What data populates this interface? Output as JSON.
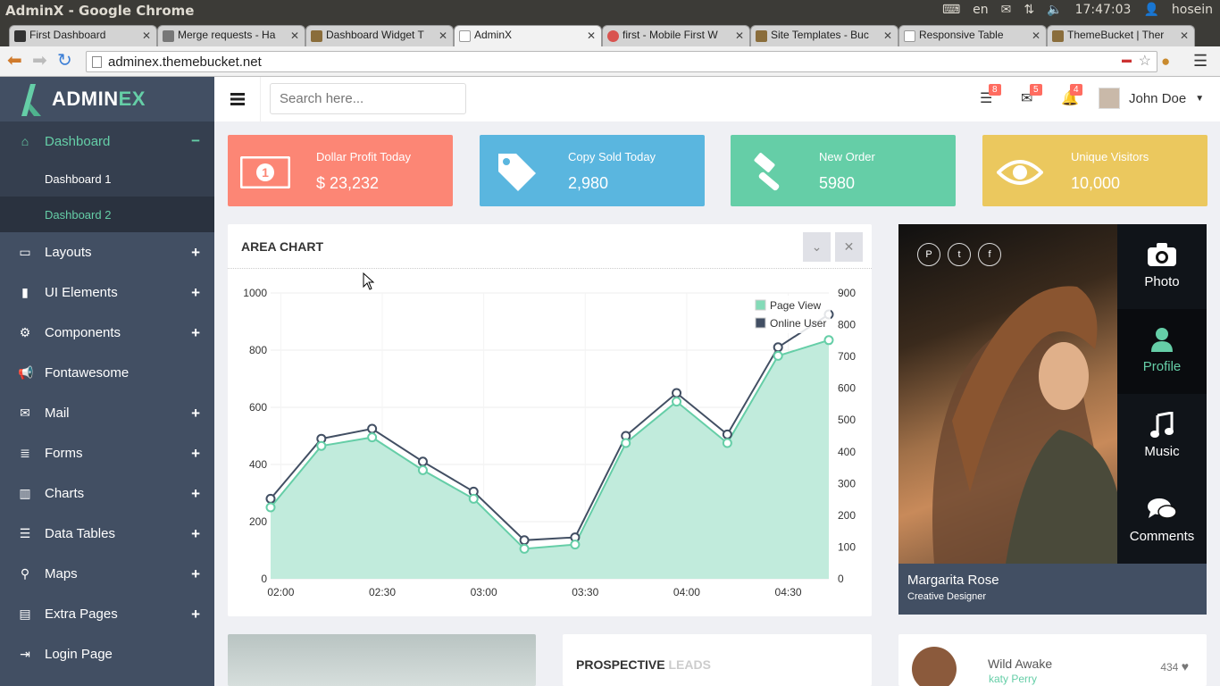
{
  "os": {
    "window_title": "AdminX - Google Chrome",
    "keyboard_lang": "en",
    "clock": "17:47:03",
    "user": "hosein"
  },
  "browser": {
    "tabs": [
      {
        "label": "First Dashboard",
        "active": false
      },
      {
        "label": "Merge requests - Ha",
        "active": false
      },
      {
        "label": "Dashboard Widget T",
        "active": false
      },
      {
        "label": "AdminX",
        "active": true
      },
      {
        "label": "first - Mobile First W",
        "active": false
      },
      {
        "label": "Site Templates - Buc",
        "active": false
      },
      {
        "label": "Responsive Table",
        "active": false
      },
      {
        "label": "ThemeBucket | Ther",
        "active": false
      }
    ],
    "url": "adminex.themebucket.net"
  },
  "brand": {
    "name_a": "ADMIN",
    "name_b": "EX"
  },
  "sidebar": {
    "items": [
      {
        "label": "Dashboard",
        "toggle": "−",
        "active": true
      },
      {
        "label": "Layouts",
        "toggle": "+"
      },
      {
        "label": "UI Elements",
        "toggle": "+"
      },
      {
        "label": "Components",
        "toggle": "+"
      },
      {
        "label": "Fontawesome",
        "toggle": ""
      },
      {
        "label": "Mail",
        "toggle": "+"
      },
      {
        "label": "Forms",
        "toggle": "+"
      },
      {
        "label": "Charts",
        "toggle": "+"
      },
      {
        "label": "Data Tables",
        "toggle": "+"
      },
      {
        "label": "Maps",
        "toggle": "+"
      },
      {
        "label": "Extra Pages",
        "toggle": "+"
      },
      {
        "label": "Login Page",
        "toggle": ""
      }
    ],
    "submenu": [
      "Dashboard 1",
      "Dashboard 2"
    ]
  },
  "header": {
    "search_placeholder": "Search here...",
    "badges": {
      "tasks": "8",
      "messages": "5",
      "notifications": "4"
    },
    "user_name": "John Doe"
  },
  "stats": [
    {
      "title": "Dollar Profit Today",
      "value": "$ 23,232",
      "color": "#fc8675"
    },
    {
      "title": "Copy Sold Today",
      "value": "2,980",
      "color": "#5ab6df"
    },
    {
      "title": "New Order",
      "value": "5980",
      "color": "#65cea7"
    },
    {
      "title": "Unique Visitors",
      "value": "10,000",
      "color": "#ebc85e"
    }
  ],
  "chart_panel": {
    "title": "AREA CHART"
  },
  "chart_data": {
    "type": "area",
    "x_ticks": [
      "02:00",
      "02:30",
      "03:00",
      "03:30",
      "04:00",
      "04:30"
    ],
    "y_left_ticks": [
      "1000",
      "800",
      "600",
      "400",
      "200",
      "0"
    ],
    "y_right_ticks": [
      "900",
      "800",
      "700",
      "600",
      "500",
      "400",
      "300",
      "200",
      "100",
      "0"
    ],
    "ylim_left": [
      0,
      1000
    ],
    "ylim_right": [
      0,
      900
    ],
    "legend": [
      "Page View",
      "Online User"
    ],
    "legend_position": "top-right",
    "series": [
      {
        "name": "Page View",
        "color": "#65cea7",
        "axis": "left",
        "values": [
          250,
          465,
          495,
          380,
          280,
          105,
          120,
          475,
          620,
          475,
          780,
          835
        ]
      },
      {
        "name": "Online User",
        "color": "#424f63",
        "axis": "right",
        "values": [
          250,
          460,
          495,
          380,
          275,
          105,
          115,
          470,
          620,
          475,
          780,
          835
        ]
      }
    ]
  },
  "profile": {
    "tabs": [
      "Photo",
      "Profile",
      "Music",
      "Comments"
    ],
    "name": "Margarita Rose",
    "role": "Creative Designer"
  },
  "bottom": {
    "leads_a": "PROSPECTIVE ",
    "leads_b": "LEADS",
    "song": "Wild Awake",
    "artist": "katy Perry",
    "likes": "434"
  }
}
